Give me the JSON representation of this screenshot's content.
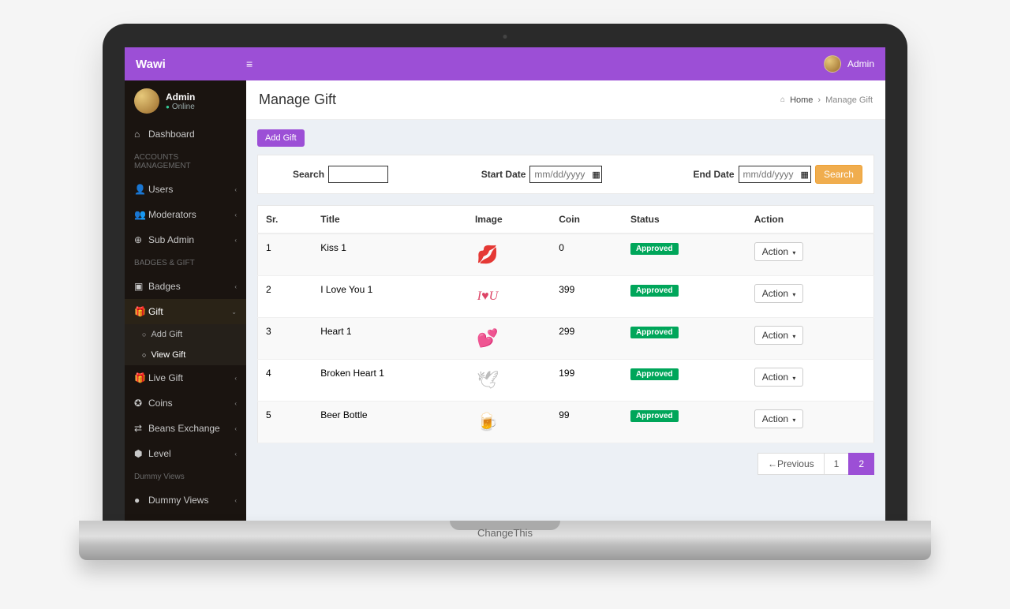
{
  "topbar": {
    "brand": "Wawi",
    "user": "Admin"
  },
  "laptop": {
    "label": "ChangeThis"
  },
  "sidebar": {
    "user": {
      "name": "Admin",
      "status": "Online"
    },
    "dashboard": "Dashboard",
    "sections": {
      "accounts": {
        "header": "ACCOUNTS MANAGEMENT",
        "items": [
          "Users",
          "Moderators",
          "Sub Admin"
        ]
      },
      "badges": {
        "header": "BADGES & GIFT",
        "items": [
          "Badges",
          "Gift",
          "Live Gift",
          "Coins",
          "Beans Exchange",
          "Level"
        ],
        "gift_sub": [
          "Add Gift",
          "View Gift"
        ]
      },
      "dummy": {
        "header": "Dummy Views",
        "items": [
          "Dummy Views"
        ]
      }
    }
  },
  "page": {
    "title": "Manage Gift",
    "breadcrumb": {
      "home": "Home",
      "current": "Manage Gift"
    },
    "add_btn": "Add Gift",
    "filters": {
      "search_label": "Search",
      "start_label": "Start Date",
      "end_label": "End Date",
      "date_placeholder": "mm/dd/yyyy",
      "search_btn": "Search"
    },
    "table": {
      "headers": [
        "Sr.",
        "Title",
        "Image",
        "Coin",
        "Status",
        "Action"
      ],
      "rows": [
        {
          "sr": "1",
          "title": "Kiss 1",
          "img": "kiss",
          "coin": "0",
          "status": "Approved"
        },
        {
          "sr": "2",
          "title": "I Love You 1",
          "img": "love",
          "coin": "399",
          "status": "Approved"
        },
        {
          "sr": "3",
          "title": "Heart 1",
          "img": "heart",
          "coin": "299",
          "status": "Approved"
        },
        {
          "sr": "4",
          "title": "Broken Heart 1",
          "img": "broken",
          "coin": "199",
          "status": "Approved"
        },
        {
          "sr": "5",
          "title": "Beer Bottle",
          "img": "bottle",
          "coin": "99",
          "status": "Approved"
        }
      ],
      "action_label": "Action"
    },
    "pagination": {
      "prev": "←Previous",
      "pages": [
        "1",
        "2"
      ],
      "active": "2"
    }
  }
}
